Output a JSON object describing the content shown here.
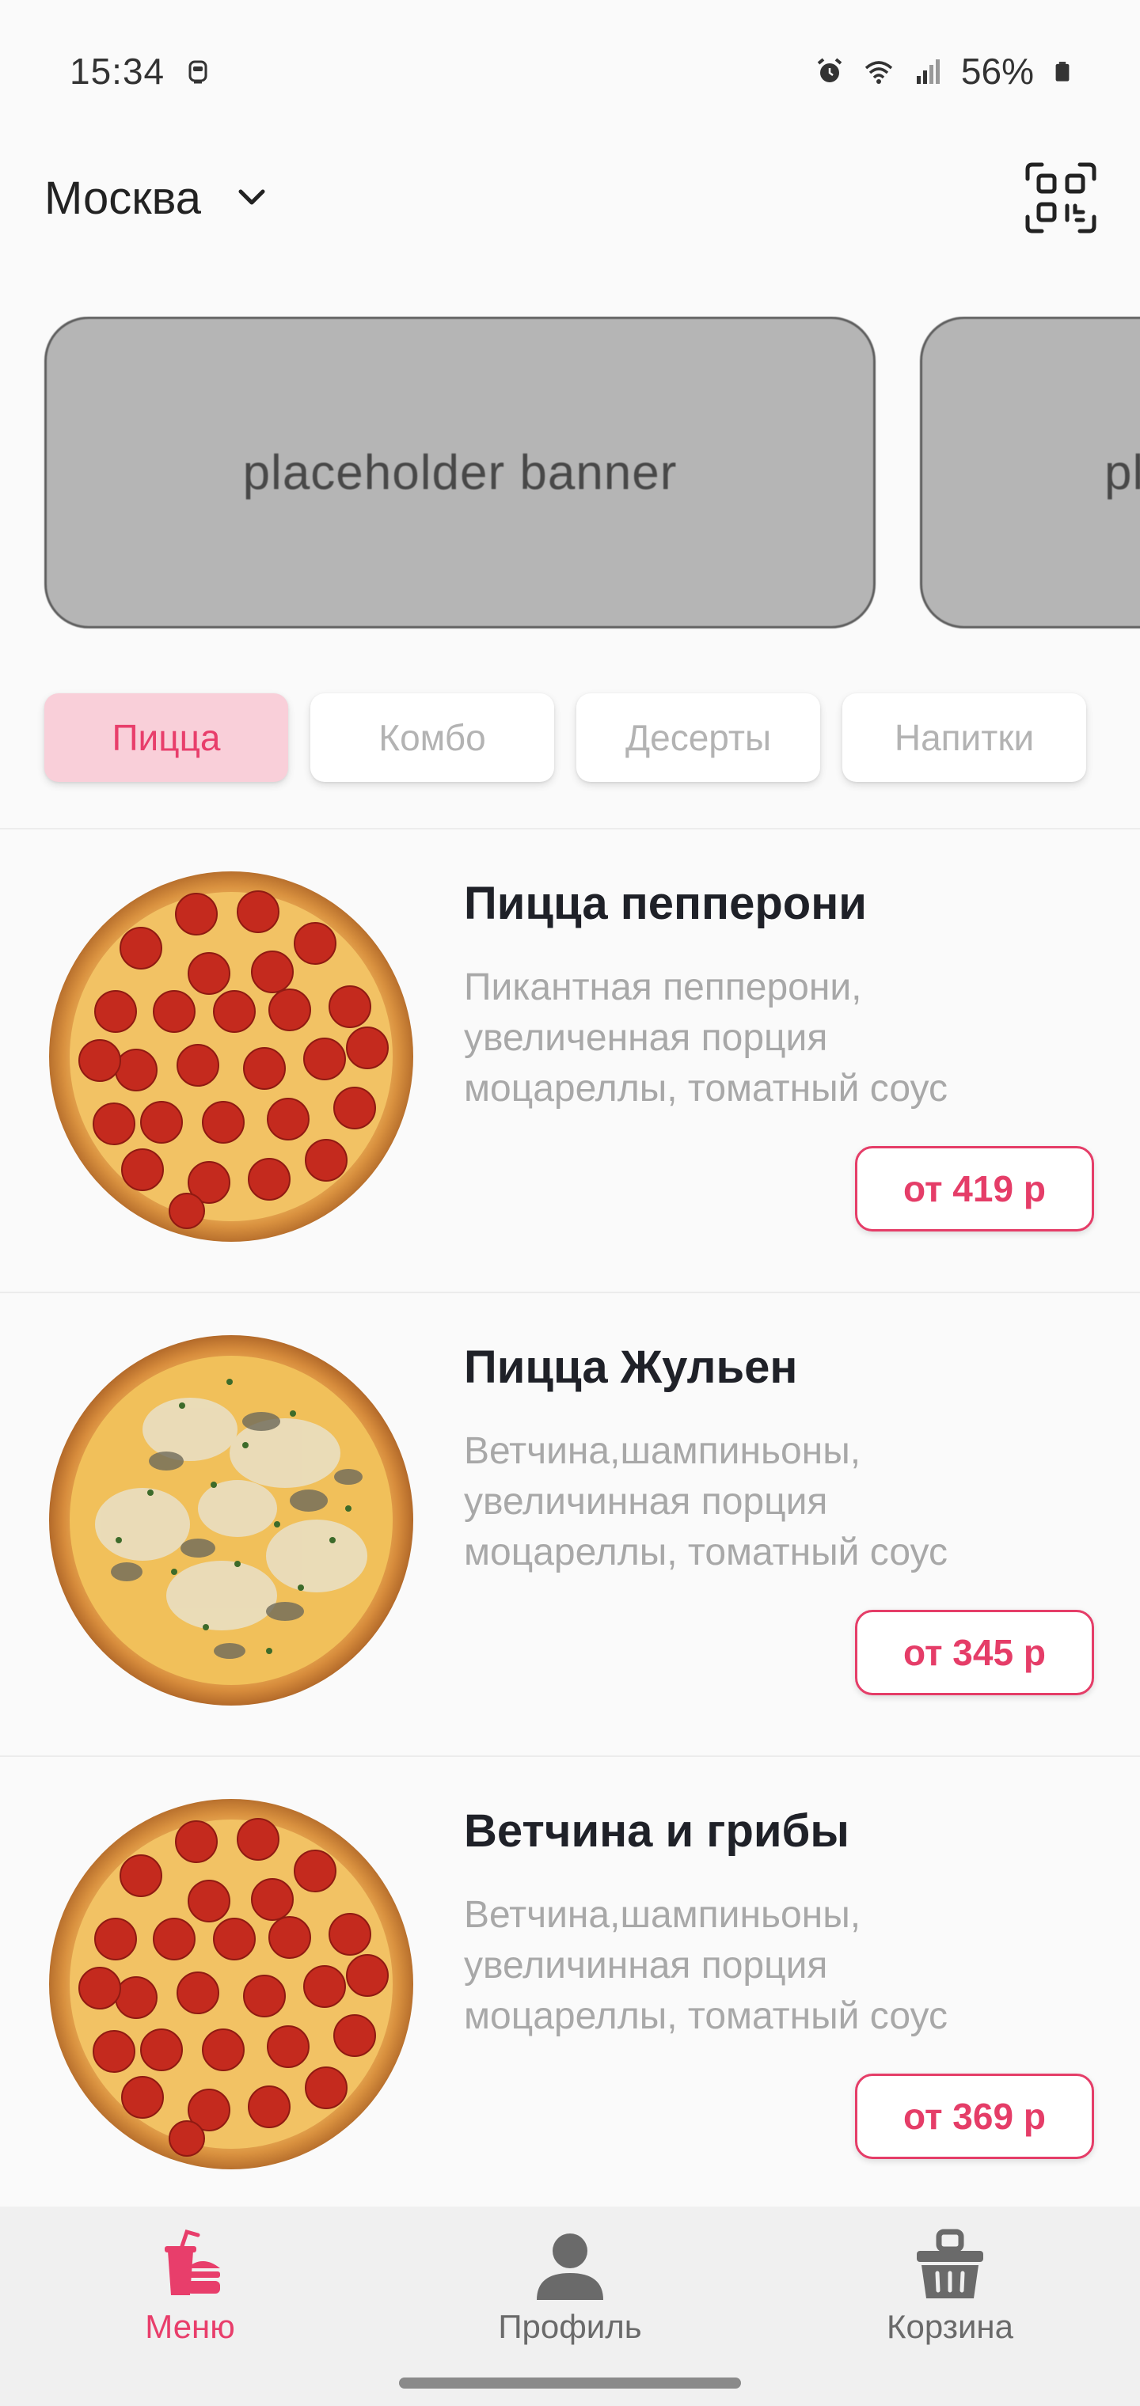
{
  "status_bar": {
    "time": "15:34",
    "battery": "56%",
    "icons": [
      "notification-icon",
      "alarm-icon",
      "wifi-icon",
      "signal-icon",
      "battery-icon"
    ]
  },
  "header": {
    "city": "Москва",
    "icons": [
      "chevron-down-icon",
      "qr-code-icon"
    ]
  },
  "banners": [
    "placeholder banner",
    "pl"
  ],
  "categories": [
    {
      "label": "Пицца",
      "active": true
    },
    {
      "label": "Комбо",
      "active": false
    },
    {
      "label": "Десерты",
      "active": false
    },
    {
      "label": "Напитки",
      "active": false
    }
  ],
  "products": [
    {
      "name": "Пицца пепперони",
      "description_lines": [
        "Пикантная пепперони,",
        "увеличенная порция",
        "моцареллы, томатный соус"
      ],
      "price": "от 419 р",
      "image": "pepperoni-pizza"
    },
    {
      "name": "Пицца Жульен",
      "description_lines": [
        "Ветчина,шампиньоны,",
        "увеличинная порция",
        "моцареллы, томатный соус"
      ],
      "price": "от 345 р",
      "image": "julienne-pizza"
    },
    {
      "name": "Ветчина и грибы",
      "description_lines": [
        "Ветчина,шампиньоны,",
        "увеличинная порция",
        "моцареллы, томатный соус"
      ],
      "price": "от 369 р",
      "image": "pepperoni-pizza"
    }
  ],
  "bottom_nav": [
    {
      "label": "Меню",
      "icon": "menu-food-icon",
      "active": true
    },
    {
      "label": "Профиль",
      "icon": "profile-icon",
      "active": false
    },
    {
      "label": "Корзина",
      "icon": "basket-icon",
      "active": false
    }
  ],
  "colors": {
    "accent": "#e83e6b",
    "active_tab_bg": "#f9cfd9",
    "banner_bg": "#b5b5b5",
    "description": "#a8a8a8"
  }
}
